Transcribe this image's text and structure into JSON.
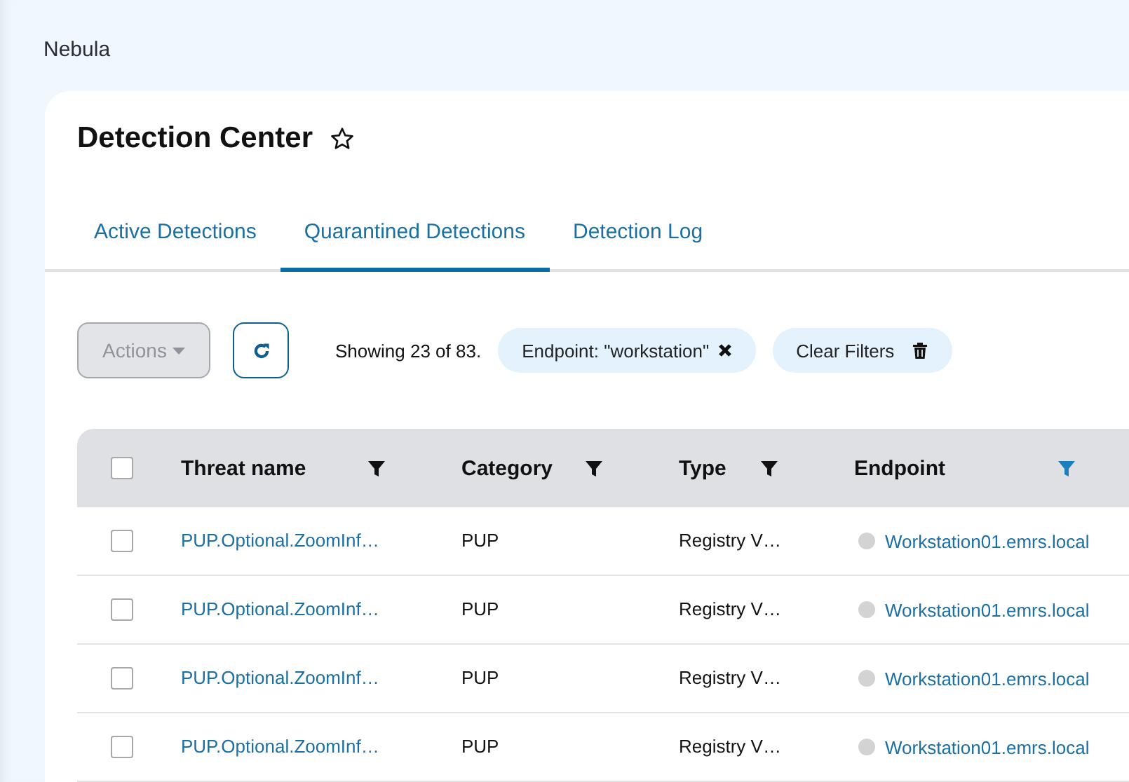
{
  "app": {
    "name": "Nebula"
  },
  "page": {
    "title": "Detection Center",
    "favorite": false
  },
  "tabs": [
    {
      "label": "Active Detections",
      "selected": false
    },
    {
      "label": "Quarantined Detections",
      "selected": true
    },
    {
      "label": "Detection Log",
      "selected": false
    }
  ],
  "toolbar": {
    "actions": {
      "label": "Actions",
      "disabled": true
    },
    "showing": "Showing 23 of 83.",
    "filter_chips": [
      {
        "label": "Endpoint: \"workstation\""
      }
    ],
    "clear_filters": "Clear Filters"
  },
  "table": {
    "select_all": false,
    "columns": [
      {
        "label": "Threat name",
        "filtered": false
      },
      {
        "label": "Category",
        "filtered": false
      },
      {
        "label": "Type",
        "filtered": false
      },
      {
        "label": "Endpoint",
        "filtered": true
      }
    ],
    "rows": [
      {
        "checked": false,
        "threat": "PUP.Optional.ZoomInf…",
        "category": "PUP",
        "type": "Registry V…",
        "endpoint": "Workstation01.emrs.local"
      },
      {
        "checked": false,
        "threat": "PUP.Optional.ZoomInf…",
        "category": "PUP",
        "type": "Registry V…",
        "endpoint": "Workstation01.emrs.local"
      },
      {
        "checked": false,
        "threat": "PUP.Optional.ZoomInf…",
        "category": "PUP",
        "type": "Registry V…",
        "endpoint": "Workstation01.emrs.local"
      },
      {
        "checked": false,
        "threat": "PUP.Optional.ZoomInf…",
        "category": "PUP",
        "type": "Registry V…",
        "endpoint": "Workstation01.emrs.local"
      }
    ]
  }
}
